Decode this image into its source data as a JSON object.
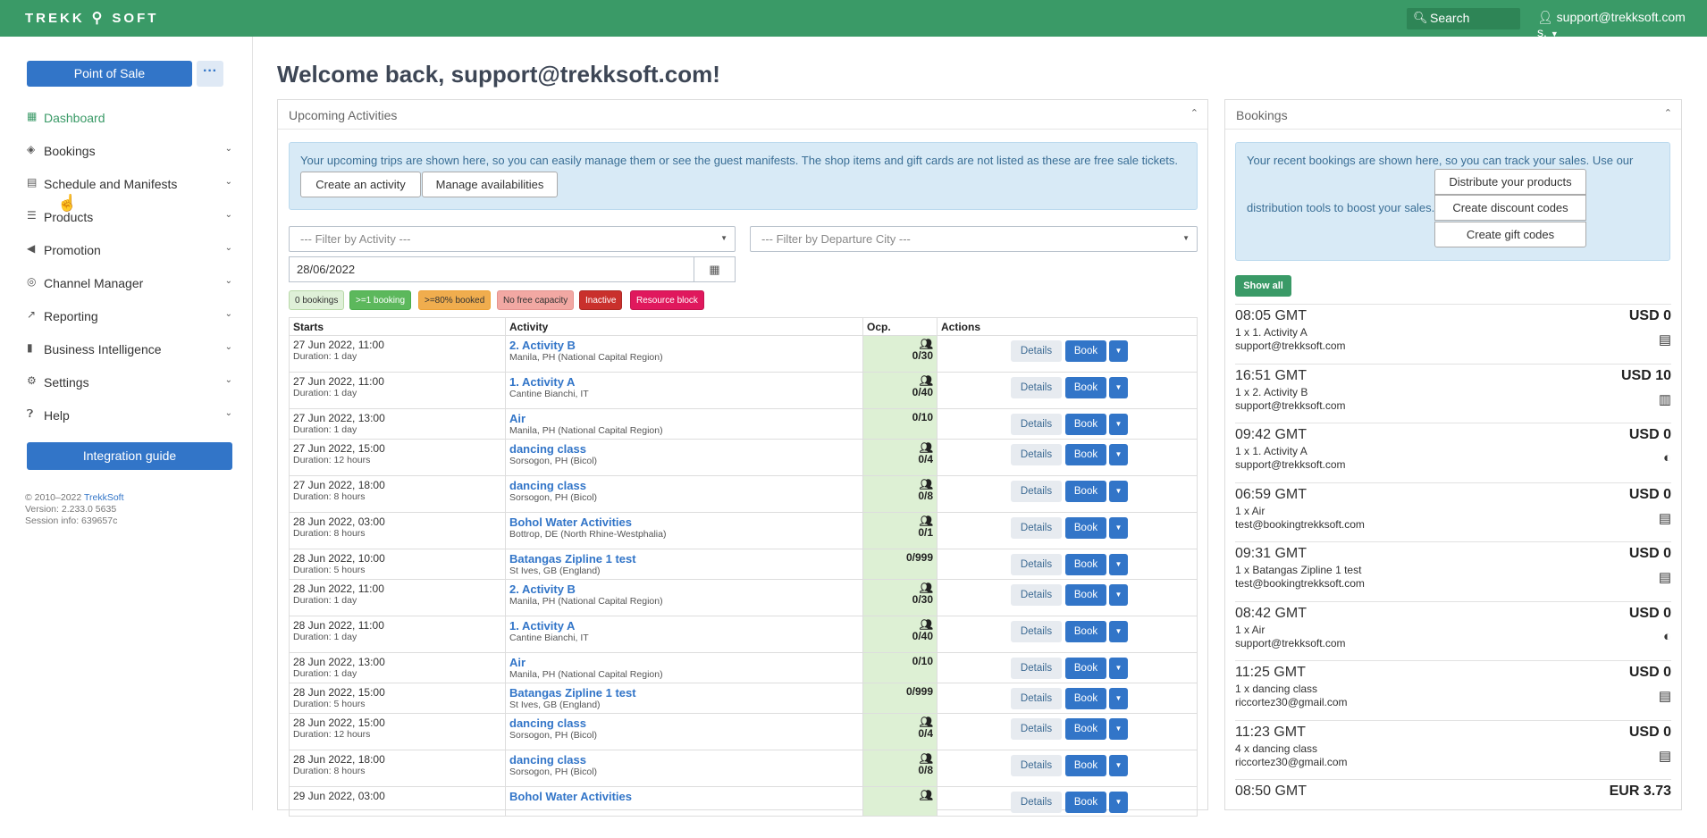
{
  "app": {
    "logo_left": "TREKK",
    "logo_right": "SOFT",
    "search_label": "Search",
    "user_label": "support@trekksoft.com s."
  },
  "sidebar": {
    "pos_label": "Point of Sale",
    "more_label": "···",
    "items": [
      {
        "label": "Dashboard",
        "icon": "grid-icon"
      },
      {
        "label": "Bookings",
        "icon": "tag-icon"
      },
      {
        "label": "Schedule and Manifests",
        "icon": "calendar-icon"
      },
      {
        "label": "Products",
        "icon": "list-icon"
      },
      {
        "label": "Promotion",
        "icon": "megaphone-icon"
      },
      {
        "label": "Channel Manager",
        "icon": "globe-icon"
      },
      {
        "label": "Reporting",
        "icon": "line-chart-icon"
      },
      {
        "label": "Business Intelligence",
        "icon": "bar-chart-icon"
      },
      {
        "label": "Settings",
        "icon": "gear-icon"
      },
      {
        "label": "Help",
        "icon": "help-icon"
      }
    ],
    "integration_label": "Integration guide",
    "footer_copyright": "© 2010–2022",
    "footer_brand": "TrekkSoft",
    "footer_version": "Version: 2.233.0 5635",
    "footer_session": "Session info: 639657c"
  },
  "main": {
    "welcome": "Welcome back, support@trekksoft.com!"
  },
  "upcoming": {
    "title": "Upcoming Activities",
    "info": "Your upcoming trips are shown here, so you can easily manage them or see the guest manifests. The shop items and gift cards are not listed as these are free sale tickets.",
    "create_label": "Create an activity",
    "manage_label": "Manage availabilities",
    "filter_activity": "--- Filter by Activity ---",
    "filter_city": "--- Filter by Departure City ---",
    "date_value": "28/06/2022",
    "legend": [
      {
        "label": "0 bookings",
        "bg": "#dff0d8",
        "fg": "#333",
        "border": "#b8d9a8"
      },
      {
        "label": ">=1 booking",
        "bg": "#5cb85c",
        "fg": "#fff",
        "border": "#4cae4c"
      },
      {
        "label": ">=80% booked",
        "bg": "#f0ad4e",
        "fg": "#333",
        "border": "#eea236"
      },
      {
        "label": "No free capacity",
        "bg": "#f2a8a3",
        "fg": "#333",
        "border": "#e69490"
      },
      {
        "label": "Inactive",
        "bg": "#c9302c",
        "fg": "#fff",
        "border": "#ac2925"
      },
      {
        "label": "Resource block",
        "bg": "#e0185d",
        "fg": "#fff",
        "border": "#c4144f"
      }
    ],
    "columns": {
      "starts": "Starts",
      "activity": "Activity",
      "ocp": "Ocp.",
      "actions": "Actions"
    },
    "details_label": "Details",
    "book_label": "Book",
    "rows": [
      {
        "start": "27 Jun 2022, 11:00",
        "duration": "Duration: 1 day",
        "activity": "2. Activity B",
        "location": "Manila, PH (National Capital Region)",
        "ocp": "0/30",
        "people": true
      },
      {
        "start": "27 Jun 2022, 11:00",
        "duration": "Duration: 1 day",
        "activity": "1. Activity A",
        "location": "Cantine Bianchi, IT",
        "ocp": "0/40",
        "people": true
      },
      {
        "start": "27 Jun 2022, 13:00",
        "duration": "Duration: 1 day",
        "activity": "Air",
        "location": "Manila, PH (National Capital Region)",
        "ocp": "0/10",
        "people": false
      },
      {
        "start": "27 Jun 2022, 15:00",
        "duration": "Duration: 12 hours",
        "activity": "dancing class",
        "location": "Sorsogon, PH (Bicol)",
        "ocp": "0/4",
        "people": true
      },
      {
        "start": "27 Jun 2022, 18:00",
        "duration": "Duration: 8 hours",
        "activity": "dancing class",
        "location": "Sorsogon, PH (Bicol)",
        "ocp": "0/8",
        "people": true
      },
      {
        "start": "28 Jun 2022, 03:00",
        "duration": "Duration: 8 hours",
        "activity": "Bohol Water Activities",
        "location": "Bottrop, DE (North Rhine-Westphalia)",
        "ocp": "0/1",
        "people": true
      },
      {
        "start": "28 Jun 2022, 10:00",
        "duration": "Duration: 5 hours",
        "activity": "Batangas Zipline 1 test",
        "location": "St Ives, GB (England)",
        "ocp": "0/999",
        "people": false
      },
      {
        "start": "28 Jun 2022, 11:00",
        "duration": "Duration: 1 day",
        "activity": "2. Activity B",
        "location": "Manila, PH (National Capital Region)",
        "ocp": "0/30",
        "people": true
      },
      {
        "start": "28 Jun 2022, 11:00",
        "duration": "Duration: 1 day",
        "activity": "1. Activity A",
        "location": "Cantine Bianchi, IT",
        "ocp": "0/40",
        "people": true
      },
      {
        "start": "28 Jun 2022, 13:00",
        "duration": "Duration: 1 day",
        "activity": "Air",
        "location": "Manila, PH (National Capital Region)",
        "ocp": "0/10",
        "people": false
      },
      {
        "start": "28 Jun 2022, 15:00",
        "duration": "Duration: 5 hours",
        "activity": "Batangas Zipline 1 test",
        "location": "St Ives, GB (England)",
        "ocp": "0/999",
        "people": false
      },
      {
        "start": "28 Jun 2022, 15:00",
        "duration": "Duration: 12 hours",
        "activity": "dancing class",
        "location": "Sorsogon, PH (Bicol)",
        "ocp": "0/4",
        "people": true
      },
      {
        "start": "28 Jun 2022, 18:00",
        "duration": "Duration: 8 hours",
        "activity": "dancing class",
        "location": "Sorsogon, PH (Bicol)",
        "ocp": "0/8",
        "people": true
      },
      {
        "start": "29 Jun 2022, 03:00",
        "duration": "",
        "activity": "Bohol Water Activities",
        "location": "",
        "ocp": "",
        "people": true
      }
    ]
  },
  "bookings": {
    "title": "Bookings",
    "info_line1": "Your recent bookings are shown here, so you can track your sales. Use our",
    "info_line2": "distribution tools to boost your sales.",
    "distribute_label": "Distribute your products",
    "discount_label": "Create discount codes",
    "gift_label": "Create gift codes",
    "show_all_label": "Show all",
    "items": [
      {
        "time": "08:05 GMT",
        "amount": "USD 0",
        "desc": "1 x 1. Activity A",
        "email": "support@trekksoft.com",
        "icon": "map-icon"
      },
      {
        "time": "16:51 GMT",
        "amount": "USD 10",
        "desc": "1 x 2. Activity B",
        "email": "support@trekksoft.com",
        "icon": "calculator-icon"
      },
      {
        "time": "09:42 GMT",
        "amount": "USD 0",
        "desc": "1 x 1. Activity A",
        "email": "support@trekksoft.com",
        "icon": "globe-icon"
      },
      {
        "time": "06:59 GMT",
        "amount": "USD 0",
        "desc": "1 x Air",
        "email": "test@bookingtrekksoft.com",
        "icon": "map-icon"
      },
      {
        "time": "09:31 GMT",
        "amount": "USD 0",
        "desc": "1 x Batangas Zipline 1 test",
        "email": "test@bookingtrekksoft.com",
        "icon": "map-icon"
      },
      {
        "time": "08:42 GMT",
        "amount": "USD 0",
        "desc": "1 x Air",
        "email": "support@trekksoft.com",
        "icon": "globe-icon"
      },
      {
        "time": "11:25 GMT",
        "amount": "USD 0",
        "desc": "1 x dancing class",
        "email": "riccortez30@gmail.com",
        "icon": "map-icon"
      },
      {
        "time": "11:23 GMT",
        "amount": "USD 0",
        "desc": "4 x dancing class",
        "email": "riccortez30@gmail.com",
        "icon": "map-icon"
      },
      {
        "time": "08:50 GMT",
        "amount": "EUR 3.73",
        "desc": "",
        "email": "",
        "icon": ""
      }
    ]
  }
}
